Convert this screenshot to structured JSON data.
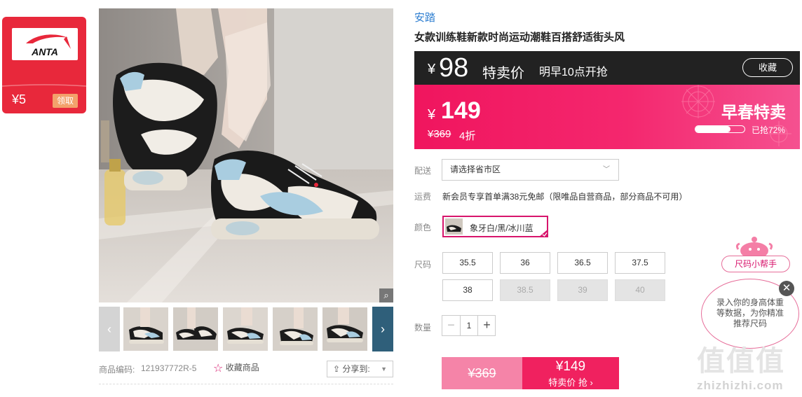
{
  "coupon": {
    "brand_logo_text": "ANTA",
    "amount": "¥5",
    "claim_label": "领取"
  },
  "gallery": {
    "prev_icon": "chevron-left-icon",
    "next_icon": "chevron-right-icon",
    "zoom_icon": "magnifier-icon",
    "thumbnail_count": 5
  },
  "product_meta": {
    "sku_label": "商品编码:",
    "sku_value": "121937772R-5",
    "favorite_label": "收藏商品",
    "share_label": "分享到:"
  },
  "product": {
    "brand": "安踏",
    "title": "女款训练鞋新款时尚运动潮鞋百搭舒适街头风"
  },
  "preview": {
    "currency": "¥",
    "price": "98",
    "label": "特卖价",
    "start_time": "明早10点开抢",
    "collect_label": "收藏"
  },
  "promo": {
    "currency": "¥",
    "price": "149",
    "original_price": "¥369",
    "discount": "4折",
    "name": "早春特卖",
    "sold_ratio": 0.72,
    "sold_text": "已抢72%"
  },
  "delivery": {
    "label": "配送",
    "select_value": "请选择省市区"
  },
  "shipping": {
    "label": "运费",
    "text": "新会员专享首单满38元免邮（限唯品自营商品，部分商品不可用）"
  },
  "color": {
    "label": "颜色",
    "selected": "象牙白/黑/冰川蓝"
  },
  "size": {
    "label": "尺码",
    "options": [
      {
        "value": "35.5",
        "available": true
      },
      {
        "value": "36",
        "available": true
      },
      {
        "value": "36.5",
        "available": true
      },
      {
        "value": "37.5",
        "available": true
      },
      {
        "value": "38",
        "available": true
      },
      {
        "value": "38.5",
        "available": false
      },
      {
        "value": "39",
        "available": false
      },
      {
        "value": "40",
        "available": false
      }
    ]
  },
  "quantity": {
    "label": "数量",
    "value": "1",
    "minus": "−",
    "plus": "+"
  },
  "buy": {
    "original_price": "¥369",
    "price": "¥149",
    "action_label": "特卖价 抢 ›"
  },
  "size_helper": {
    "title": "尺码小帮手",
    "text": "录入你的身高体重等数据，为你精准推荐尺码",
    "close_icon": "close-icon"
  },
  "watermark": {
    "logo": "值值值",
    "url": "zhizhizhi.com"
  },
  "colors": {
    "brand_red": "#e8283b",
    "accent_pink": "#f0155e",
    "preview_bg": "#222222",
    "link_blue": "#2f7fd1"
  }
}
